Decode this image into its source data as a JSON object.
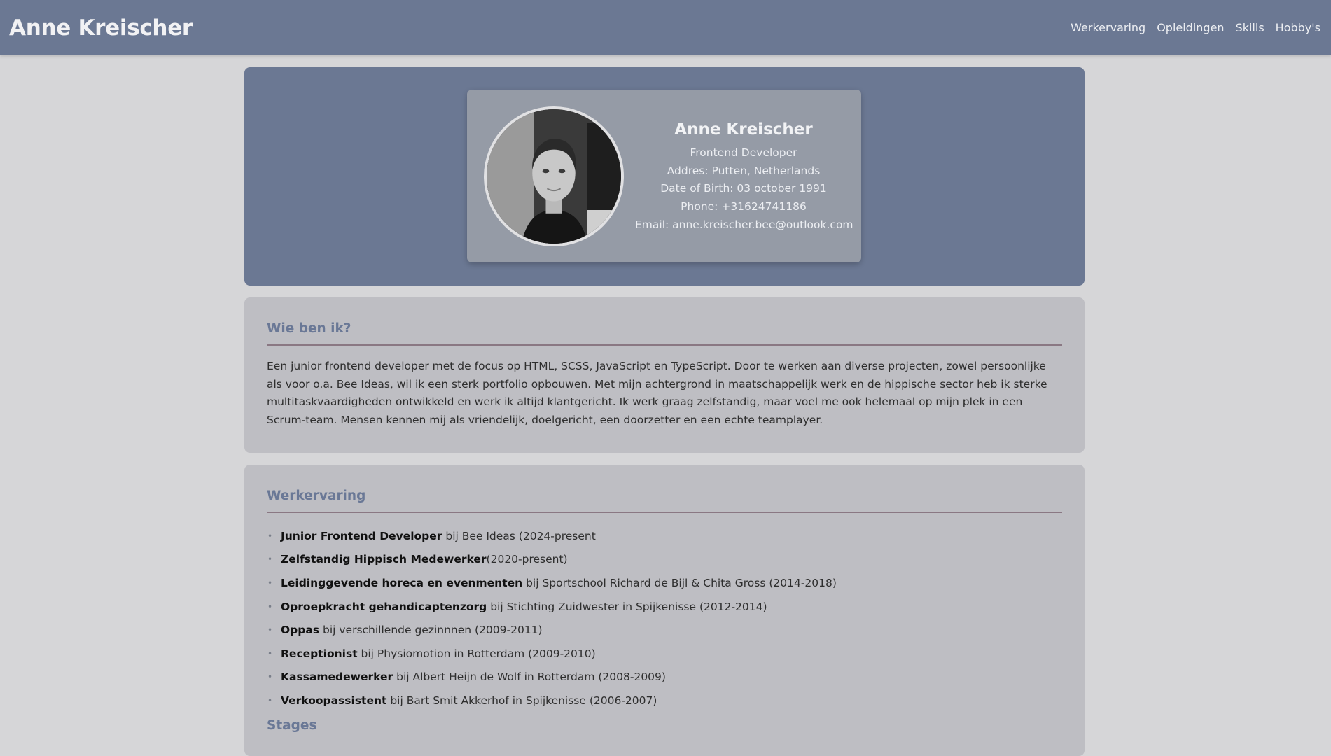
{
  "header": {
    "brand": "Anne Kreischer",
    "nav": [
      "Werkervaring",
      "Opleidingen",
      "Skills",
      "Hobby's"
    ]
  },
  "profile": {
    "name": "Anne Kreischer",
    "lines": [
      "Frontend Developer",
      "Addres: Putten, Netherlands",
      "Date of Birth: 03 october 1991",
      "Phone: +31624741186",
      "Email: anne.kreischer.bee@outlook.com"
    ]
  },
  "about": {
    "title": "Wie ben ik?",
    "text": "Een junior frontend developer met de focus op HTML, SCSS, JavaScript en TypeScript. Door te werken aan diverse projecten, zowel persoonlijke als voor o.a. Bee Ideas, wil ik een sterk portfolio opbouwen. Met mijn achtergrond in maatschappelijk werk en de hippische sector heb ik sterke multitaskvaardigheden ontwikkeld en werk ik altijd klantgericht. Ik werk graag zelfstandig, maar voel me ook helemaal op mijn plek in een Scrum-team. Mensen kennen mij als vriendelijk, doelgericht, een doorzetter en een echte teamplayer."
  },
  "experience": {
    "title": "Werkervaring",
    "bullet": "•",
    "items": [
      {
        "role": "Junior Frontend Developer",
        "detail": " bij Bee Ideas (2024-present"
      },
      {
        "role": "Zelfstandig Hippisch Medewerker",
        "detail": "(2020-present)"
      },
      {
        "role": "Leidinggevende horeca en evenmenten",
        "detail": " bij Sportschool Richard de Bijl & Chita Gross (2014-2018)"
      },
      {
        "role": "Oproepkracht gehandicaptenzorg",
        "detail": " bij Stichting Zuidwester in Spijkenisse (2012-2014)"
      },
      {
        "role": "Oppas",
        "detail": " bij verschillende gezinnnen (2009-2011)"
      },
      {
        "role": "Receptionist",
        "detail": " bij Physiomotion in Rotterdam (2009-2010)"
      },
      {
        "role": "Kassamedewerker",
        "detail": " bij Albert Heijn de Wolf in Rotterdam (2008-2009)"
      },
      {
        "role": "Verkoopassistent",
        "detail": " bij Bart Smit Akkerhof in Spijkenisse (2006-2007)"
      }
    ],
    "next_heading": "Stages"
  }
}
